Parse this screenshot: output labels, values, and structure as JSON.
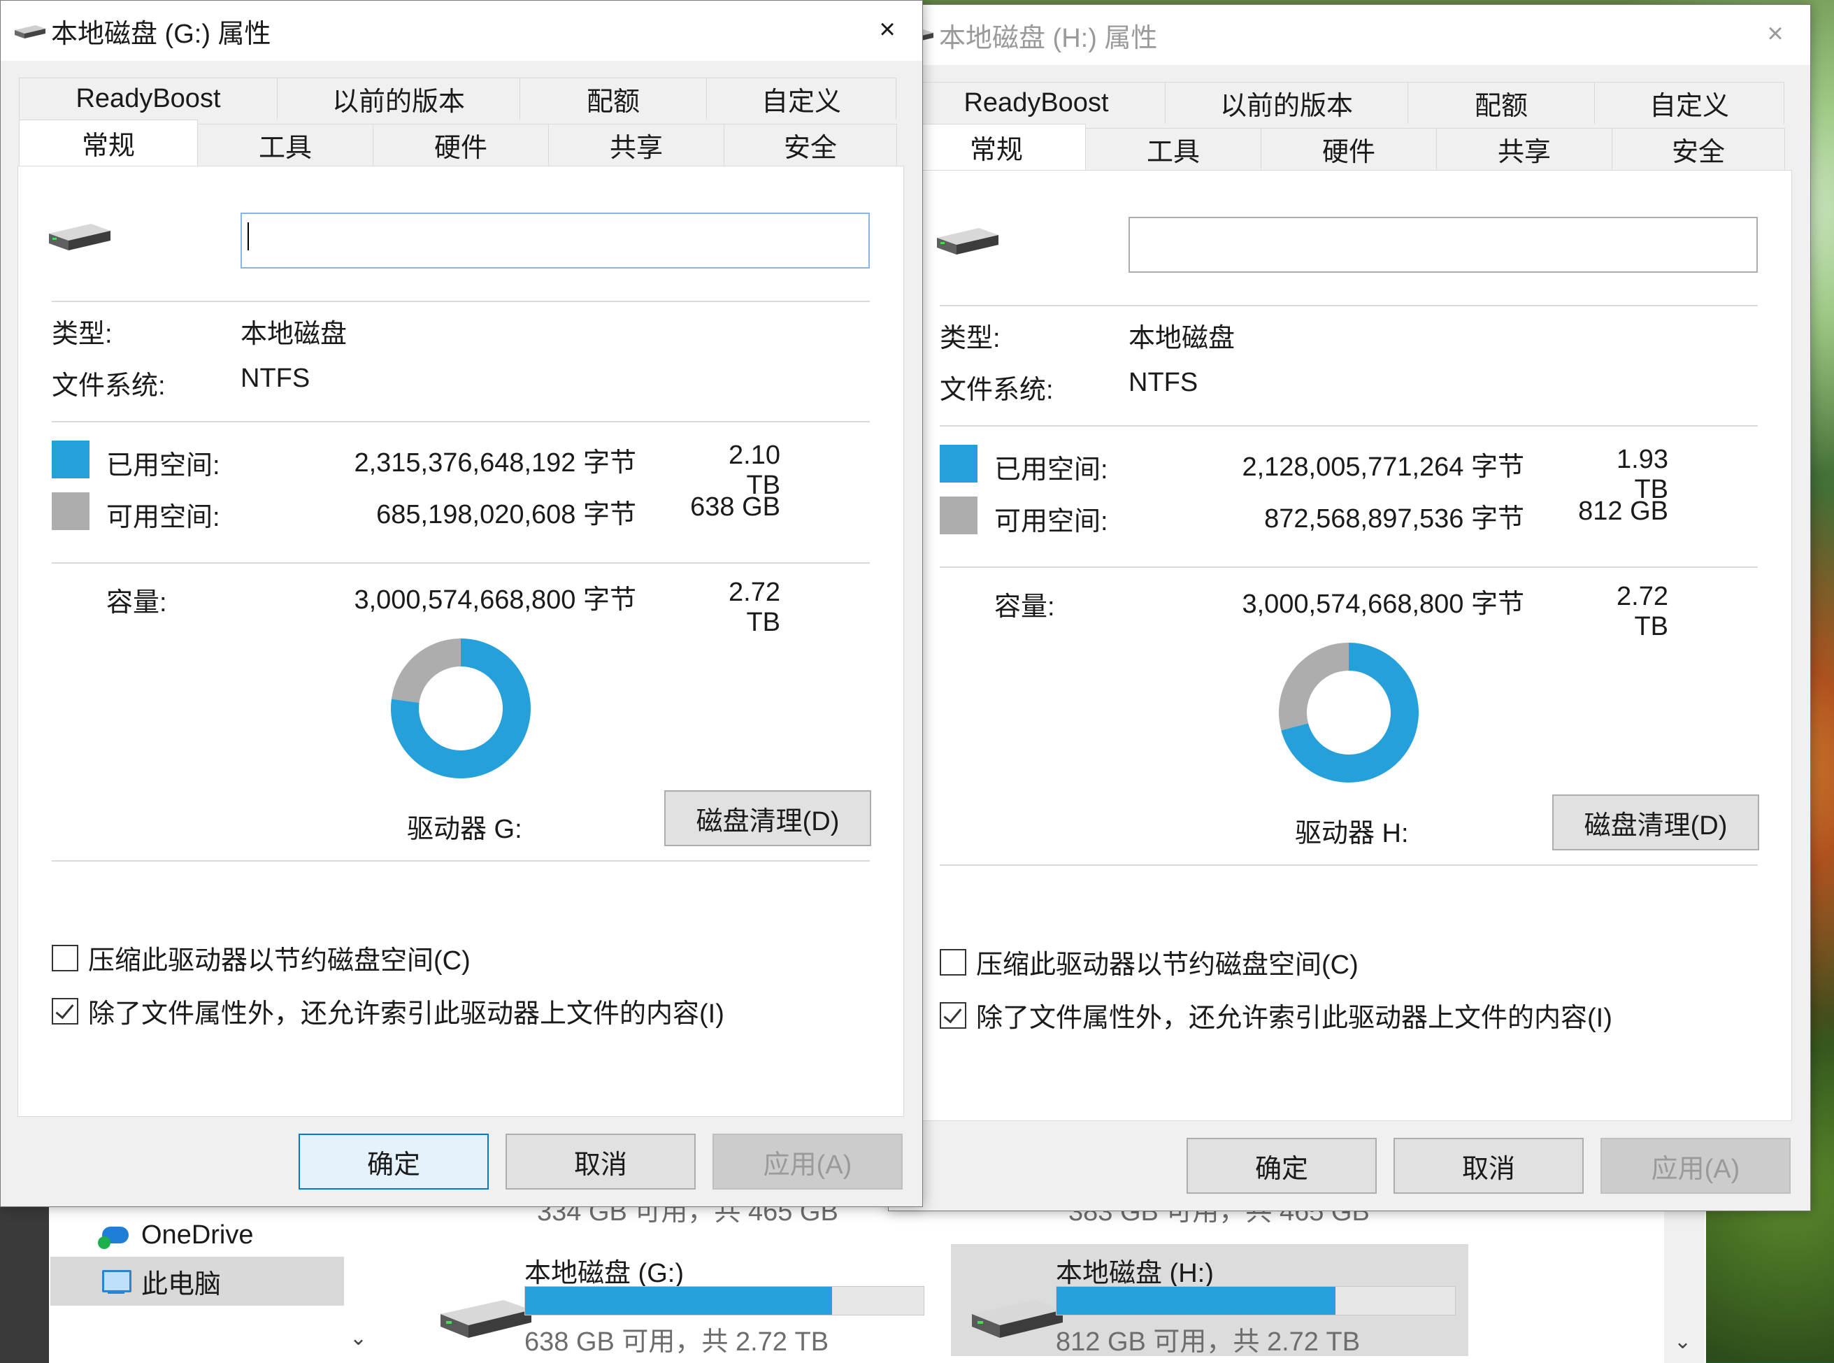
{
  "explorer": {
    "nav": {
      "items": [
        {
          "label": "OneDrive",
          "icon": "onedrive-cloud-icon"
        },
        {
          "label": "此电脑",
          "icon": "this-pc-icon",
          "selected": true
        }
      ]
    },
    "drives_top_free": [
      "334 GB 可用，共 465 GB",
      "383 GB 可用，共 465 GB"
    ],
    "drives": [
      {
        "name": "本地磁盘 (G:)",
        "free_text": "638 GB 可用，共 2.72 TB",
        "used_fraction": 0.77,
        "selected": false
      },
      {
        "name": "本地磁盘 (H:)",
        "free_text": "812 GB 可用，共 2.72 TB",
        "used_fraction": 0.7,
        "selected": true
      }
    ]
  },
  "dialogs": [
    {
      "title": "本地磁盘 (G:) 属性",
      "active": true,
      "close": "×",
      "tabs_top": [
        "ReadyBoost",
        "以前的版本",
        "配额",
        "自定义"
      ],
      "tabs_bottom": [
        "常规",
        "工具",
        "硬件",
        "共享",
        "安全"
      ],
      "active_tab": "常规",
      "volume_name": "",
      "type_label": "类型:",
      "type_value": "本地磁盘",
      "fs_label": "文件系统:",
      "fs_value": "NTFS",
      "used_label": "已用空间:",
      "used_bytes": "2,315,376,648,192 字节",
      "used_size": "2.10 TB",
      "free_label": "可用空间:",
      "free_bytes": "685,198,020,608 字节",
      "free_size": "638 GB",
      "capacity_label": "容量:",
      "capacity_bytes": "3,000,574,668,800 字节",
      "capacity_size": "2.72 TB",
      "used_fraction": 0.7716,
      "drive_label": "驱动器 G:",
      "cleanup_button": "磁盘清理(D)",
      "compress_label": "压缩此驱动器以节约磁盘空间(C)",
      "compress_checked": false,
      "index_label": "除了文件属性外，还允许索引此驱动器上文件的内容(I)",
      "index_checked": true,
      "ok_button": "确定",
      "cancel_button": "取消",
      "apply_button": "应用(A)"
    },
    {
      "title": "本地磁盘 (H:) 属性",
      "active": false,
      "close": "×",
      "tabs_top": [
        "ReadyBoost",
        "以前的版本",
        "配额",
        "自定义"
      ],
      "tabs_bottom": [
        "常规",
        "工具",
        "硬件",
        "共享",
        "安全"
      ],
      "active_tab": "常规",
      "volume_name": "",
      "type_label": "类型:",
      "type_value": "本地磁盘",
      "fs_label": "文件系统:",
      "fs_value": "NTFS",
      "used_label": "已用空间:",
      "used_bytes": "2,128,005,771,264 字节",
      "used_size": "1.93 TB",
      "free_label": "可用空间:",
      "free_bytes": "872,568,897,536 字节",
      "free_size": "812 GB",
      "capacity_label": "容量:",
      "capacity_bytes": "3,000,574,668,800 字节",
      "capacity_size": "2.72 TB",
      "used_fraction": 0.7092,
      "drive_label": "驱动器 H:",
      "cleanup_button": "磁盘清理(D)",
      "compress_label": "压缩此驱动器以节约磁盘空间(C)",
      "compress_checked": false,
      "index_label": "除了文件属性外，还允许索引此驱动器上文件的内容(I)",
      "index_checked": true,
      "ok_button": "确定",
      "cancel_button": "取消",
      "apply_button": "应用(A)"
    }
  ],
  "colors": {
    "used": "#26a0da",
    "free": "#adadad",
    "accent": "#0078d7"
  }
}
